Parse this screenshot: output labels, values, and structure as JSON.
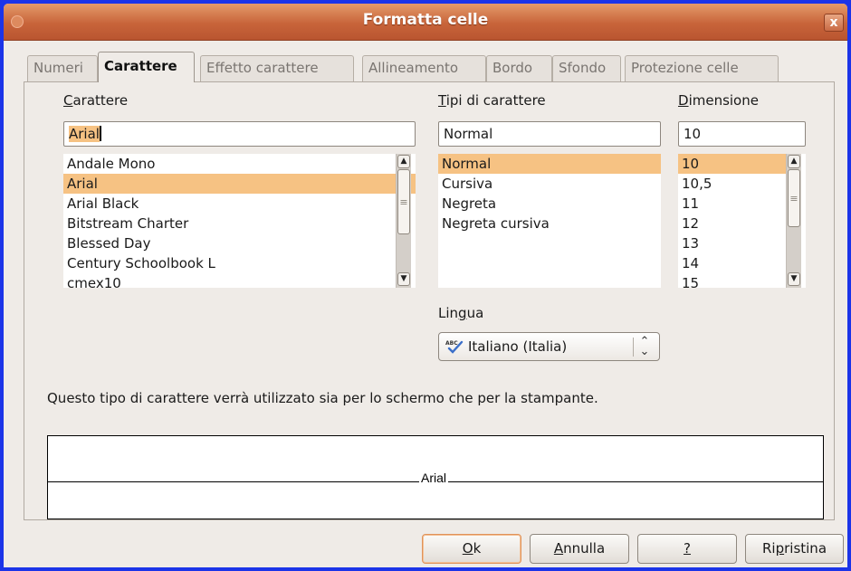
{
  "window": {
    "title": "Formatta celle",
    "close_symbol": "x"
  },
  "tabs": [
    {
      "label": "Numeri",
      "active": false
    },
    {
      "label": "Carattere",
      "active": true
    },
    {
      "label": "Effetto carattere",
      "active": false
    },
    {
      "label": "Allineamento",
      "active": false
    },
    {
      "label": "Bordo",
      "active": false
    },
    {
      "label": "Sfondo",
      "active": false
    },
    {
      "label": "Protezione celle",
      "active": false
    }
  ],
  "font": {
    "label_mnemonic": "C",
    "label_rest": "arattere",
    "value": "Arial",
    "items": [
      "Andale Mono",
      "Arial",
      "Arial Black",
      "Bitstream Charter",
      "Blessed Day",
      "Century Schoolbook L",
      "cmex10"
    ],
    "selected": "Arial"
  },
  "style": {
    "label_mnemonic": "T",
    "label_rest": "ipi di carattere",
    "value": "Normal",
    "items": [
      "Normal",
      "Cursiva",
      "Negreta",
      "Negreta cursiva"
    ],
    "selected": "Normal"
  },
  "size": {
    "label_mnemonic": "D",
    "label_rest": "imensione",
    "value": "10",
    "items": [
      "10",
      "10,5",
      "11",
      "12",
      "13",
      "14",
      "15"
    ],
    "selected": "10"
  },
  "language": {
    "label_pre": "Lin",
    "label_mnemonic": "g",
    "label_post": "ua",
    "value": "Italiano (Italia)",
    "icon": "spellcheck-abc-icon"
  },
  "info_text": "Questo tipo di carattere verrà utilizzato sia per lo schermo che per la stampante.",
  "preview": {
    "text": "Arial"
  },
  "buttons": {
    "ok_mnemonic": "O",
    "ok_rest": "k",
    "cancel_mnemonic": "A",
    "cancel_rest": "nnulla",
    "help_mnemonic": "?",
    "reset_pre": "Ri",
    "reset_mnemonic": "p",
    "reset_post": "ristina"
  },
  "colors": {
    "selection": "#f6c283",
    "titlebar": "#c8643a",
    "desktop": "#1b34e8",
    "dialog": "#efebe7"
  }
}
